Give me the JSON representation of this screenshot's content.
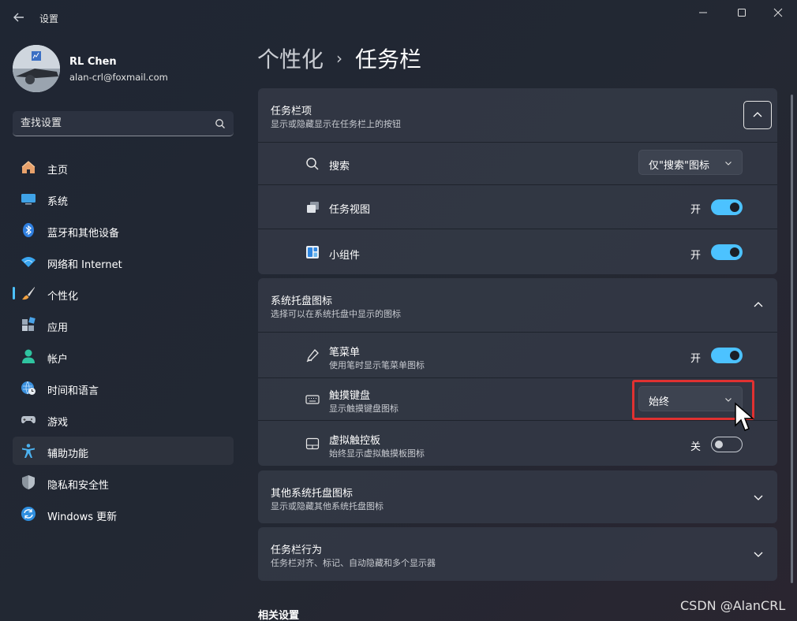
{
  "window": {
    "title": "设置"
  },
  "profile": {
    "name": "RL Chen",
    "email": "alan-crl@foxmail.com"
  },
  "search": {
    "placeholder": "查找设置"
  },
  "nav": [
    {
      "label": "主页",
      "icon": "home-icon"
    },
    {
      "label": "系统",
      "icon": "monitor-icon"
    },
    {
      "label": "蓝牙和其他设备",
      "icon": "bluetooth-icon"
    },
    {
      "label": "网络和 Internet",
      "icon": "wifi-icon"
    },
    {
      "label": "个性化",
      "icon": "brush-icon",
      "active": true
    },
    {
      "label": "应用",
      "icon": "apps-icon"
    },
    {
      "label": "帐户",
      "icon": "person-icon"
    },
    {
      "label": "时间和语言",
      "icon": "globe-clock-icon"
    },
    {
      "label": "游戏",
      "icon": "gamepad-icon"
    },
    {
      "label": "辅助功能",
      "icon": "accessibility-icon",
      "selected": true
    },
    {
      "label": "隐私和安全性",
      "icon": "shield-icon"
    },
    {
      "label": "Windows 更新",
      "icon": "update-icon"
    }
  ],
  "breadcrumb": {
    "parent": "个性化",
    "separator": "›",
    "current": "任务栏"
  },
  "taskbar_items": {
    "title": "任务栏项",
    "subtitle": "显示或隐藏显示在任务栏上的按钮",
    "search": {
      "label": "搜索",
      "value": "仅\"搜索\"图标"
    },
    "task_view": {
      "label": "任务视图",
      "state": "开"
    },
    "widgets": {
      "label": "小组件",
      "state": "开"
    }
  },
  "tray_icons": {
    "title": "系统托盘图标",
    "subtitle": "选择可以在系统托盘中显示的图标",
    "pen": {
      "label": "笔菜单",
      "desc": "使用笔时显示笔菜单图标",
      "state": "开"
    },
    "keyboard": {
      "label": "触摸键盘",
      "desc": "显示触摸键盘图标",
      "value": "始终"
    },
    "touchpad": {
      "label": "虚拟触控板",
      "desc": "始终显示虚拟触摸板图标",
      "state": "关"
    }
  },
  "other_tray": {
    "title": "其他系统托盘图标",
    "subtitle": "显示或隐藏其他系统托盘图标"
  },
  "behavior": {
    "title": "任务栏行为",
    "subtitle": "任务栏对齐、标记、自动隐藏和多个显示器"
  },
  "related": {
    "title": "相关设置"
  },
  "watermark": "CSDN @AlanCRL",
  "colors": {
    "accent": "#4cc2ff",
    "highlight": "#e03131"
  }
}
